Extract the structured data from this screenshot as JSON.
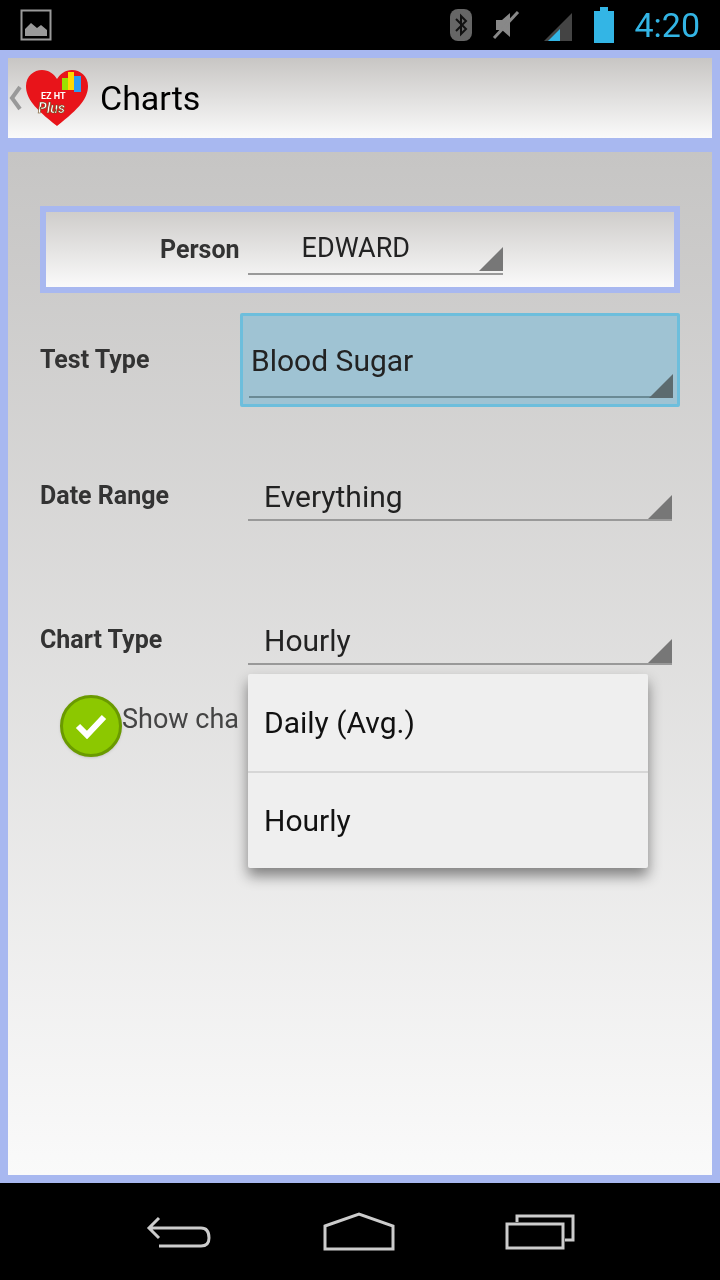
{
  "status_bar": {
    "time": "4:20"
  },
  "action_bar": {
    "title": "Charts",
    "logo_text": [
      "EZ HT",
      "Plus"
    ]
  },
  "person": {
    "label": "Person",
    "value": "EDWARD"
  },
  "fields": [
    {
      "label": "Test Type",
      "value": "Blood Sugar",
      "focused": true
    },
    {
      "label": "Date Range",
      "value": "Everything",
      "focused": false
    },
    {
      "label": "Chart Type",
      "value": "Hourly",
      "focused": false
    }
  ],
  "checkbox": {
    "label": "Show cha",
    "checked": true
  },
  "dropdown": {
    "items": [
      "Daily (Avg.)",
      "Hourly"
    ]
  }
}
